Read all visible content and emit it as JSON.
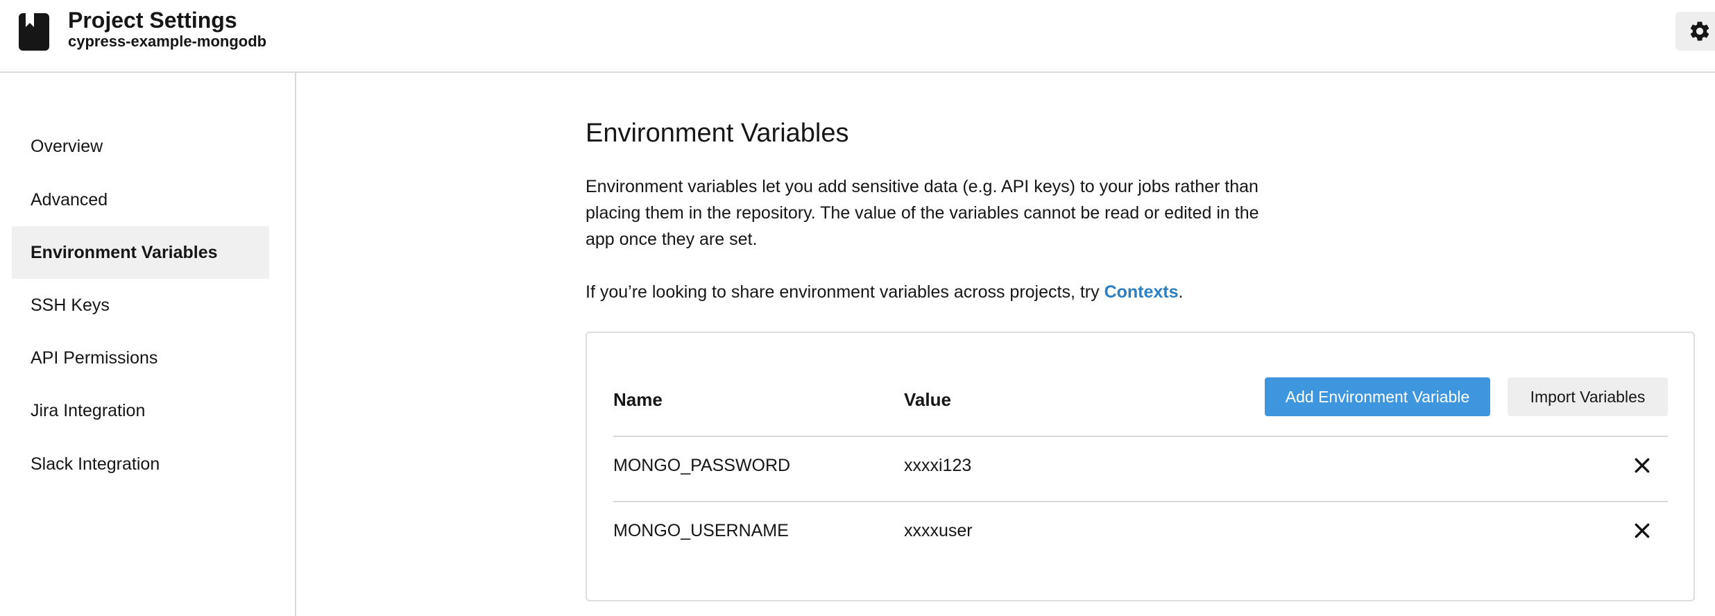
{
  "header": {
    "title": "Project Settings",
    "subtitle": "cypress-example-mongodb",
    "icon": "bookmark-book-icon",
    "settings_icon": "gear-icon"
  },
  "sidebar": {
    "items": [
      {
        "label": "Overview",
        "active": false
      },
      {
        "label": "Advanced",
        "active": false
      },
      {
        "label": "Environment Variables",
        "active": true
      },
      {
        "label": "SSH Keys",
        "active": false
      },
      {
        "label": "API Permissions",
        "active": false
      },
      {
        "label": "Jira Integration",
        "active": false
      },
      {
        "label": "Slack Integration",
        "active": false
      }
    ]
  },
  "main": {
    "title": "Environment Variables",
    "description": "Environment variables let you add sensitive data (e.g. API keys) to your jobs rather than placing them in the repository. The value of the variables cannot be read or edited in the app once they are set.",
    "contexts_prefix": "If you’re looking to share environment variables across projects, try ",
    "contexts_link": "Contexts",
    "contexts_suffix": "."
  },
  "table": {
    "columns": [
      "Name",
      "Value"
    ],
    "add_button": "Add Environment Variable",
    "import_button": "Import Variables",
    "rows": [
      {
        "name": "MONGO_PASSWORD",
        "value": "xxxxi123"
      },
      {
        "name": "MONGO_USERNAME",
        "value": "xxxxuser"
      }
    ]
  },
  "colors": {
    "accent": "#3e97de",
    "link": "#2c7fc0",
    "active_bg": "#f0f0f0",
    "border": "#d9d9d9"
  }
}
